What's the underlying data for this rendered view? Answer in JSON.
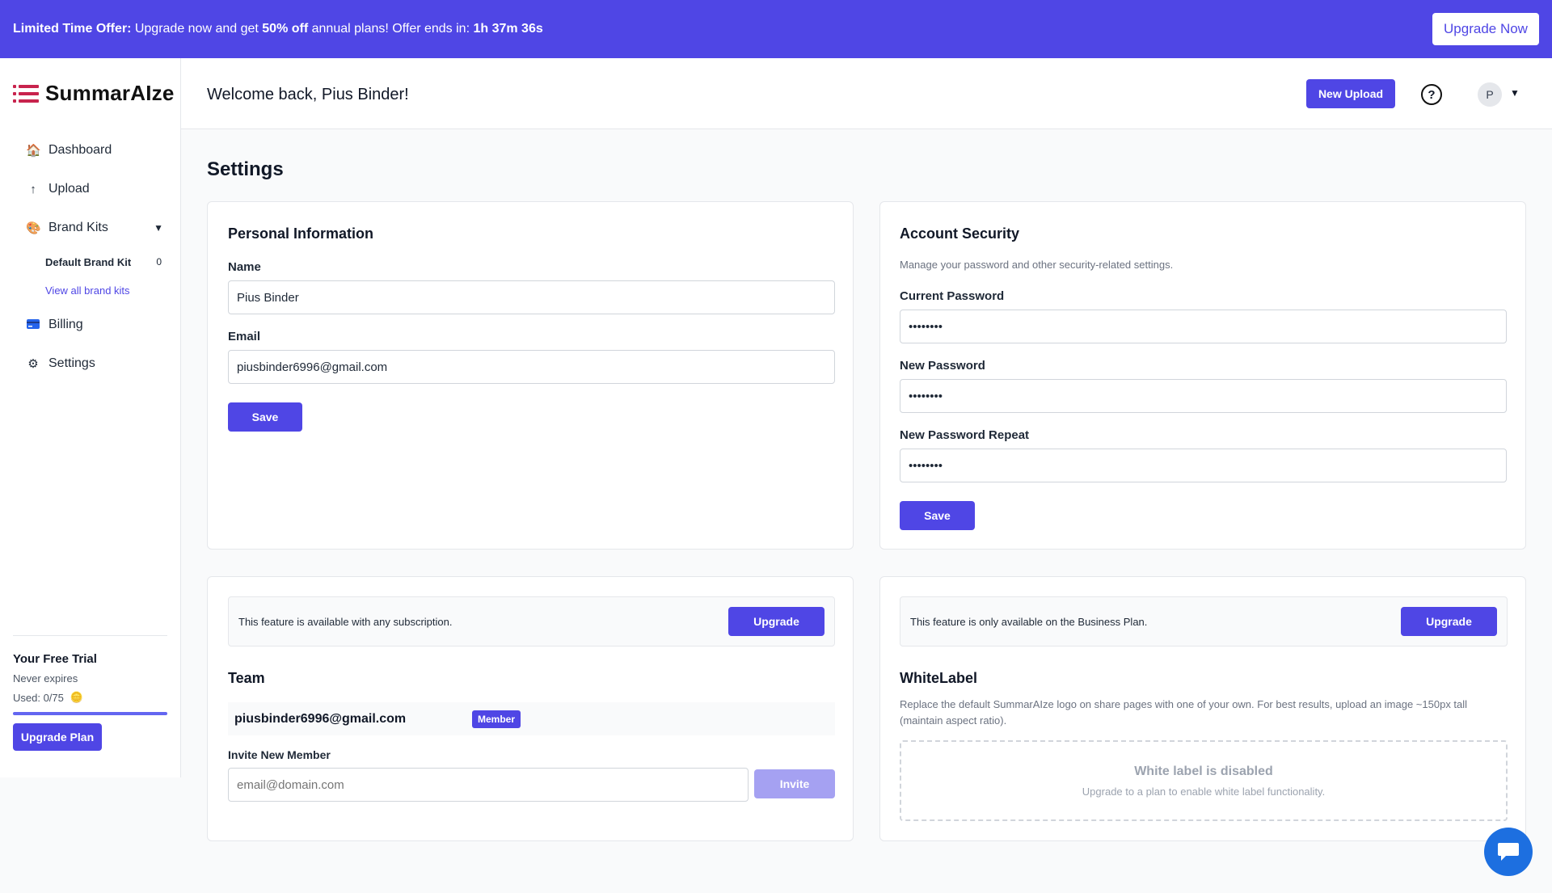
{
  "promo": {
    "lead": "Limited Time Offer:",
    "text1": " Upgrade now and get ",
    "discount": "50% off",
    "text2": " annual plans! Offer ends in: ",
    "countdown": "1h 37m 36s",
    "button": "Upgrade Now"
  },
  "sidebar": {
    "brand": "SummarAIze",
    "nav": {
      "dashboard": "Dashboard",
      "upload": "Upload",
      "brand_kits": "Brand Kits",
      "default_brand_kit": "Default Brand Kit",
      "default_brand_kit_count": "0",
      "view_all": "View all brand kits",
      "billing": "Billing",
      "settings": "Settings"
    },
    "trial": {
      "title": "Your Free Trial",
      "expiry": "Never expires",
      "used": "Used: 0/75",
      "used_fraction": 0,
      "button": "Upgrade Plan"
    }
  },
  "header": {
    "welcome": "Welcome back, Pius Binder!",
    "new_upload": "New Upload",
    "help": "?",
    "avatar": "P"
  },
  "page": {
    "title": "Settings"
  },
  "personal": {
    "title": "Personal Information",
    "name_label": "Name",
    "name_value": "Pius Binder",
    "email_label": "Email",
    "email_value": "piusbinder6996@gmail.com",
    "save": "Save"
  },
  "security": {
    "title": "Account Security",
    "subtitle": "Manage your password and other security-related settings.",
    "current_label": "Current Password",
    "current_value": "••••••••",
    "new_label": "New Password",
    "new_value": "••••••••",
    "repeat_label": "New Password Repeat",
    "repeat_value": "••••••••",
    "save": "Save"
  },
  "team": {
    "notice": "This feature is available with any subscription.",
    "upgrade": "Upgrade",
    "title": "Team",
    "member_email": "piusbinder6996@gmail.com",
    "member_role": "Member",
    "invite_label": "Invite New Member",
    "invite_placeholder": "email@domain.com",
    "invite_button": "Invite"
  },
  "whitelabel": {
    "notice": "This feature is only available on the Business Plan.",
    "upgrade": "Upgrade",
    "title": "WhiteLabel",
    "description": "Replace the default SummarAIze logo on share pages with one of your own. For best results, upload an image ~150px tall (maintain aspect ratio).",
    "disabled_title": "White label is disabled",
    "disabled_sub": "Upgrade to a plan to enable white label functionality."
  },
  "colors": {
    "accent": "#4f46e5",
    "brand_logo": "#c8234d",
    "chat": "#1d6fe0"
  }
}
